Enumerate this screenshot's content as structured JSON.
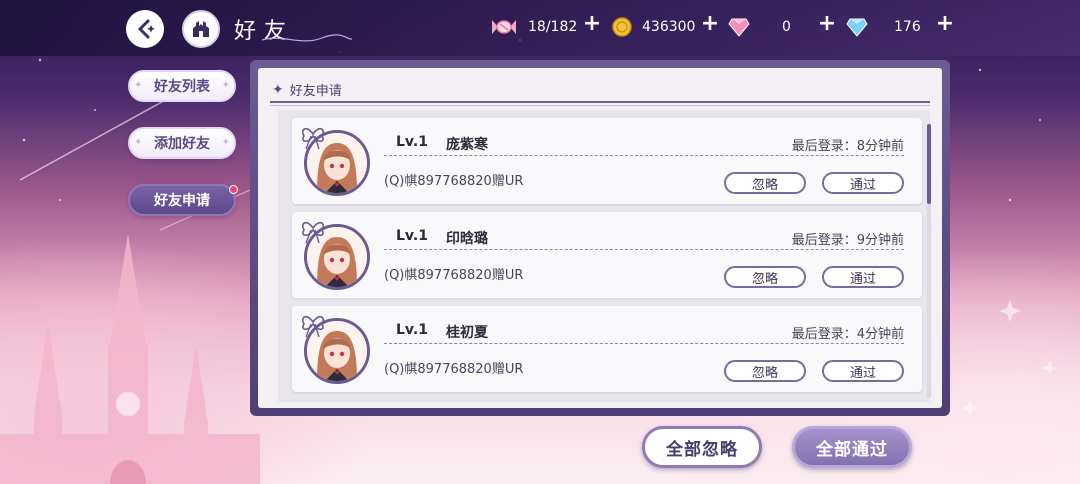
{
  "header": {
    "title": "好友",
    "resources": [
      {
        "icon": "candy-icon",
        "value": "18/182"
      },
      {
        "icon": "gold-coin-icon",
        "value": "436300"
      },
      {
        "icon": "pink-diamond-icon",
        "value": "0"
      },
      {
        "icon": "blue-diamond-icon",
        "value": "176"
      }
    ],
    "plus": "+"
  },
  "sidebar": {
    "tabs": [
      {
        "label": "好友列表",
        "active": false
      },
      {
        "label": "添加好友",
        "active": false
      },
      {
        "label": "好友申请",
        "active": true
      }
    ]
  },
  "panel": {
    "header": "好友申请",
    "requests": [
      {
        "level": "Lv.1",
        "name": "庞紫寒",
        "last_login": "最后登录：8分钟前",
        "signature": "(Q)帺897768820赠UR"
      },
      {
        "level": "Lv.1",
        "name": "印晗璐",
        "last_login": "最后登录：9分钟前",
        "signature": "(Q)帺897768820赠UR"
      },
      {
        "level": "Lv.1",
        "name": "桂初夏",
        "last_login": "最后登录：4分钟前",
        "signature": "(Q)帺897768820赠UR"
      }
    ],
    "ignore_label": "忽略",
    "accept_label": "通过"
  },
  "footer": {
    "ignore_all_label": "全部忽略",
    "accept_all_label": "全部通过"
  },
  "colors": {
    "accent": "#6d5b93",
    "accent_dark": "#4f3f75",
    "badge": "#e5487a"
  }
}
